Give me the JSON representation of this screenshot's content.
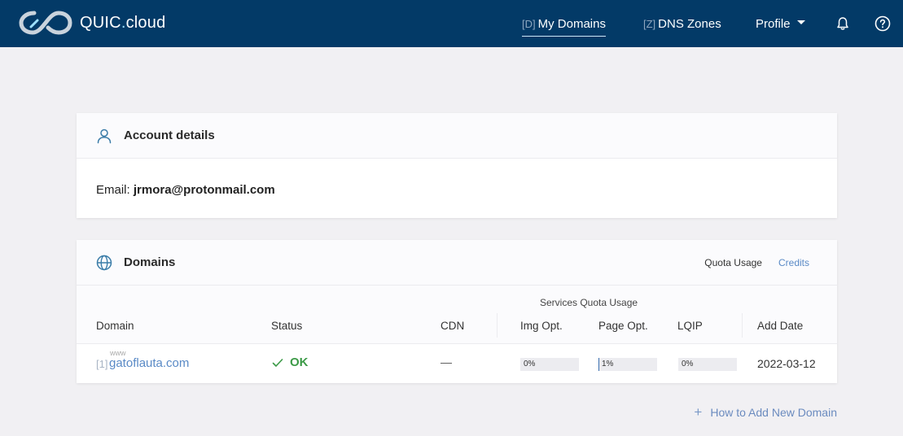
{
  "brand": {
    "name_prefix": "QUIC",
    "name_dot": ".",
    "name_suffix": "cloud"
  },
  "nav": {
    "domains": {
      "key": "[D]",
      "label": "My Domains"
    },
    "dns": {
      "key": "[Z]",
      "label": "DNS Zones"
    },
    "profile": {
      "label": "Profile"
    }
  },
  "account": {
    "title": "Account details",
    "email_label": "Email:",
    "email_value": "jrmora@protonmail.com"
  },
  "domains": {
    "title": "Domains",
    "quota_link": "Quota Usage",
    "credits_link": "Credits",
    "quota_caption": "Services Quota Usage",
    "columns": [
      "Domain",
      "Status",
      "CDN",
      "Img Opt.",
      "Page Opt.",
      "LQIP",
      "Add Date"
    ],
    "rows": [
      {
        "index": "[1]",
        "www": "www",
        "domain": "gatoflauta.com",
        "status": "OK",
        "cdn": "—",
        "img_opt": "0%",
        "img_opt_fraction": 0.0,
        "page_opt": "1%",
        "page_opt_fraction": 0.01,
        "lqip": "0%",
        "lqip_fraction": 0.0,
        "add_date": "2022-03-12"
      }
    ]
  },
  "footer": {
    "add_domain": "How to Add New Domain"
  },
  "colors": {
    "navbar": "#033a67",
    "link": "#5a8ac6",
    "ok": "#3c9a47",
    "page_bg": "#f1f0f3"
  }
}
